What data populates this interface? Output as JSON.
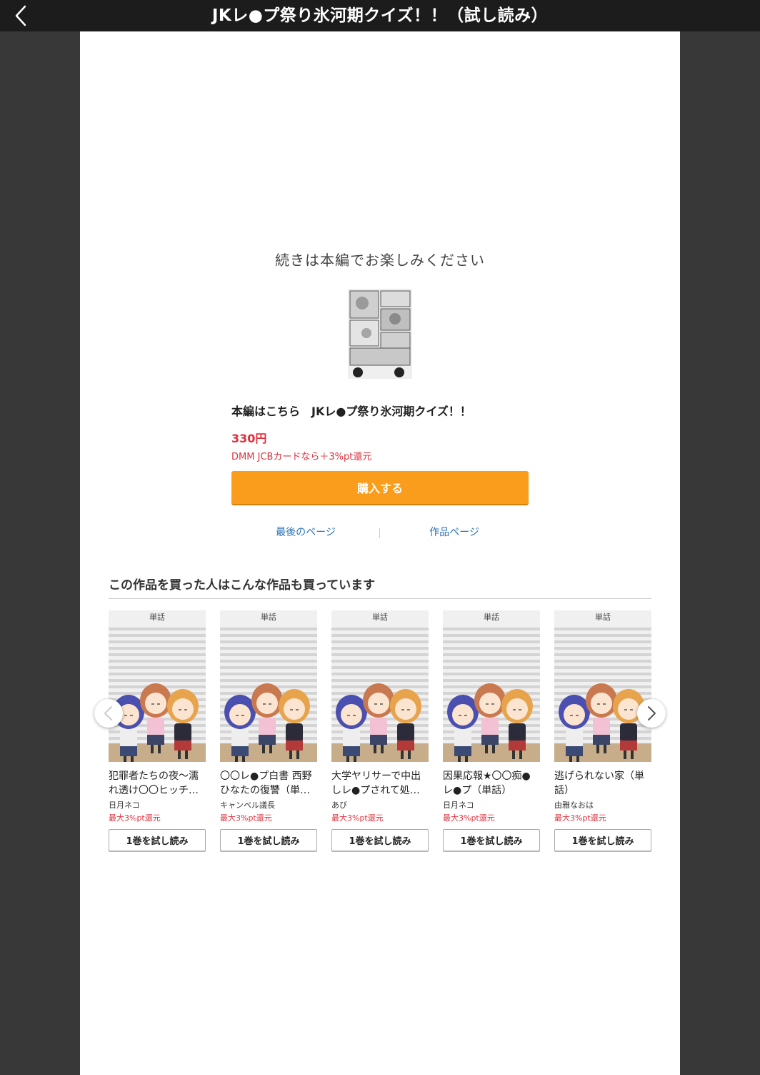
{
  "header": {
    "back_icon": "chevron-left-icon",
    "title": "JKレ●プ祭り氷河期クイズ！！（試し読み）"
  },
  "end_panel": {
    "message": "続きは本編でお楽しみください",
    "product_title": "本編はこちら　JKレ●プ祭り氷河期クイズ！！",
    "price": "330円",
    "point_note": "DMM JCBカードなら＋3%pt還元",
    "buy_label": "購入する",
    "last_page_link": "最後のページ",
    "work_page_link": "作品ページ"
  },
  "recommendations": {
    "heading": "この作品を買った人はこんな作品も買っています",
    "prev_icon": "chevron-left-icon",
    "next_icon": "chevron-right-icon",
    "items": [
      {
        "badge": "単話",
        "title": "犯罪者たちの夜〜濡れ透け〇〇ヒッチ…",
        "author": "日月ネコ",
        "point": "最大3%pt還元",
        "button": "1巻を試し読み"
      },
      {
        "badge": "単話",
        "title": "〇〇レ●プ白書 西野ひなたの復讐（単…",
        "author": "キャンベル議長",
        "point": "最大3%pt還元",
        "button": "1巻を試し読み"
      },
      {
        "badge": "単話",
        "title": "大学ヤリサーで中出しレ●プされて処…",
        "author": "あび",
        "point": "最大3%pt還元",
        "button": "1巻を試し読み"
      },
      {
        "badge": "単話",
        "title": "因果応報★〇〇痴●レ●プ（単話）",
        "author": "日月ネコ",
        "point": "最大3%pt還元",
        "button": "1巻を試し読み"
      },
      {
        "badge": "単話",
        "title": "逃げられない家（単話）",
        "author": "由雅なおは",
        "point": "最大3%pt還元",
        "button": "1巻を試し読み"
      }
    ]
  },
  "colors": {
    "accent_orange": "#fa9c1c",
    "price_red": "#e0303d",
    "link_blue": "#2d72b5"
  }
}
